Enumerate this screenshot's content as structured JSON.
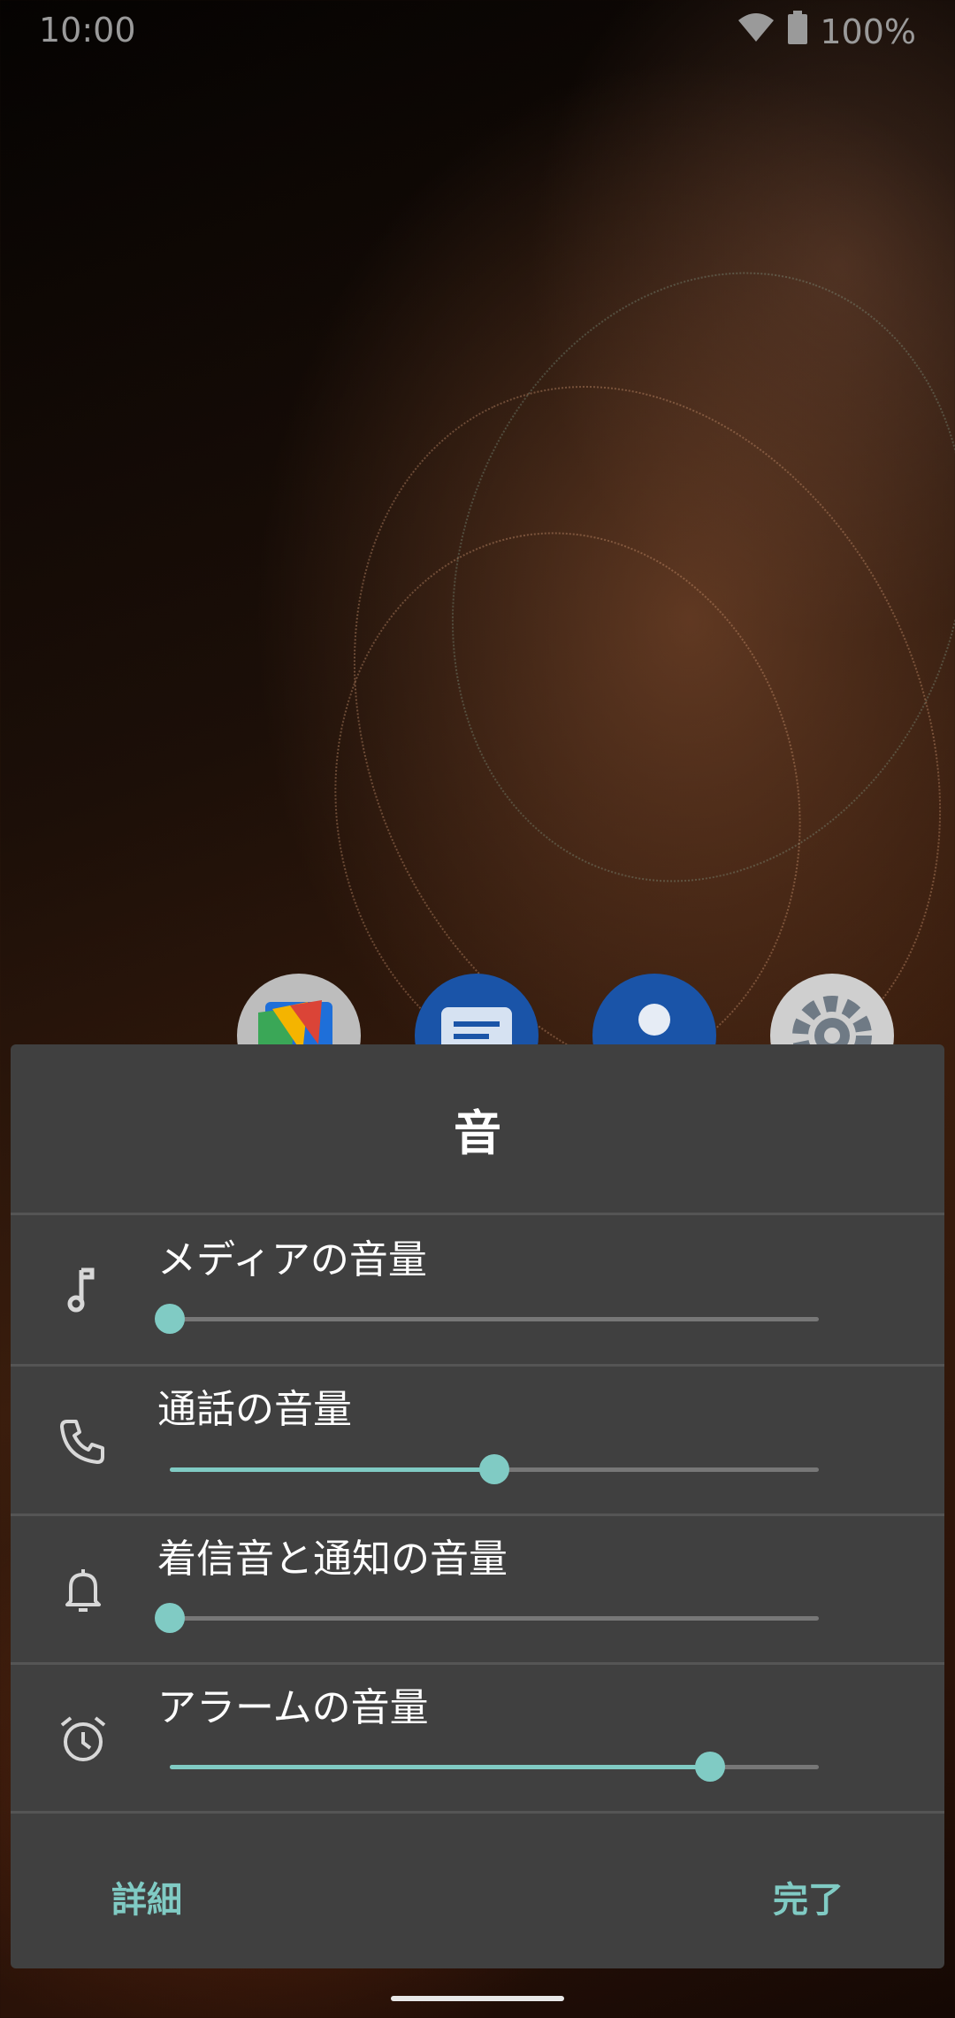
{
  "status_bar": {
    "time": "10:00",
    "battery": "100%",
    "icons": [
      "wifi-icon",
      "battery-icon"
    ]
  },
  "dock": {
    "icons": [
      "play-store-icon",
      "messages-icon",
      "contacts-icon",
      "settings-icon"
    ]
  },
  "dialog": {
    "title": "音",
    "rows": [
      {
        "icon": "music-note-icon",
        "label": "メディアの音量",
        "level": 0.0
      },
      {
        "icon": "phone-icon",
        "label": "通話の音量",
        "level": 0.5
      },
      {
        "icon": "bell-icon",
        "label": "着信音と通知の音量",
        "level": 0.0
      },
      {
        "icon": "alarm-icon",
        "label": "アラームの音量",
        "level": 0.833
      }
    ],
    "buttons": {
      "details": "詳細",
      "done": "完了"
    }
  },
  "colors": {
    "accent": "#80cbc4",
    "dialog_bg": "#404040",
    "track": "#777777",
    "status_text": "#9a9a9a"
  }
}
